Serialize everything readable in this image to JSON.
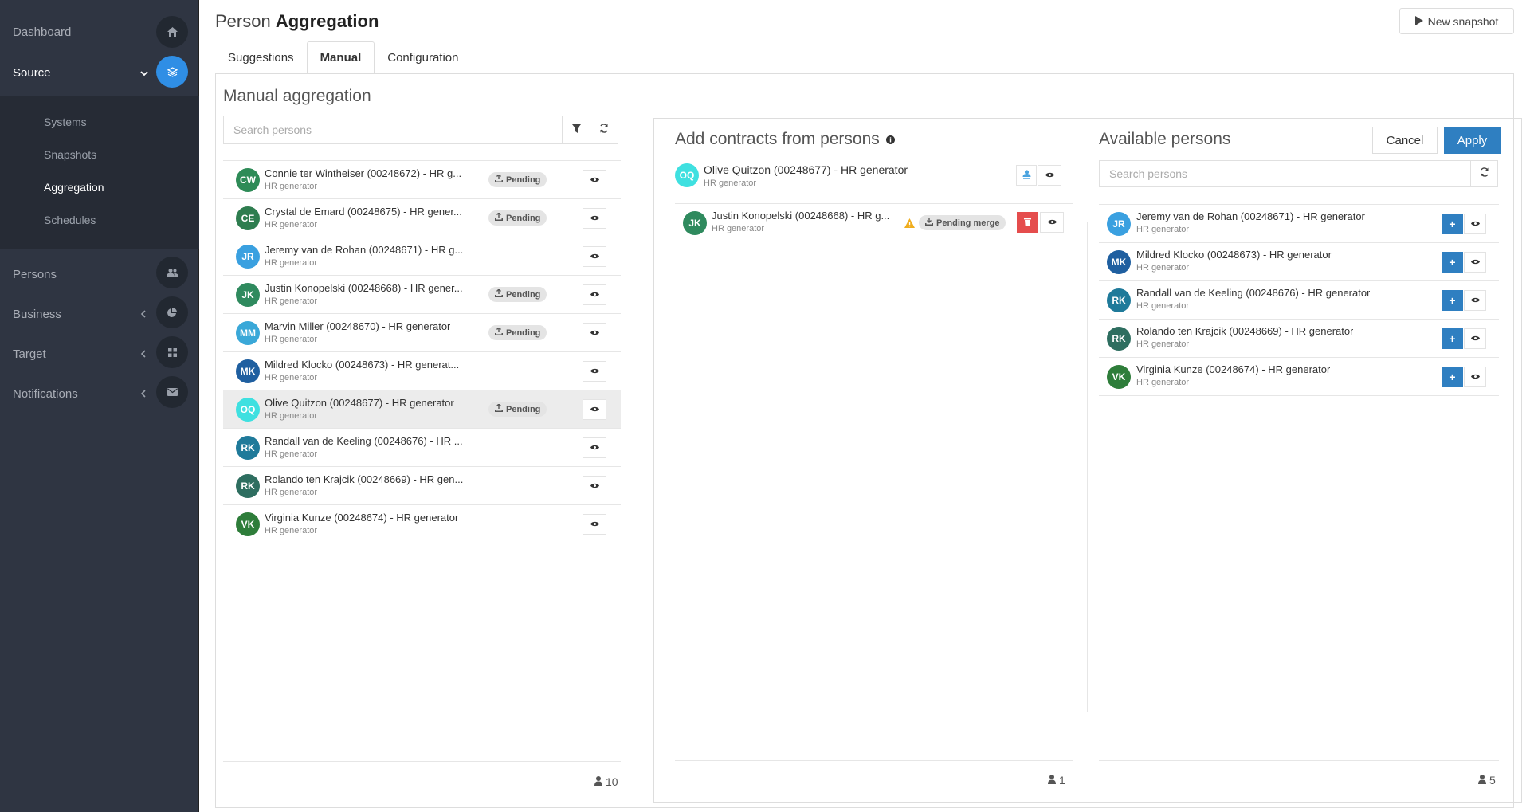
{
  "sidebar": {
    "dashboard": "Dashboard",
    "source": "Source",
    "sub": [
      "Systems",
      "Snapshots",
      "Aggregation",
      "Schedules"
    ],
    "persons": "Persons",
    "business": "Business",
    "target": "Target",
    "notifications": "Notifications"
  },
  "header": {
    "title_light": "Person",
    "title_bold": "Aggregation",
    "new_snapshot": "New snapshot"
  },
  "tabs": [
    "Suggestions",
    "Manual",
    "Configuration"
  ],
  "manual": {
    "title": "Manual aggregation",
    "search_placeholder": "Search persons",
    "count": "10",
    "persons": [
      {
        "initials": "CW",
        "color": "#2e8b57",
        "name": "Connie ter Wintheiser (00248672) - HR g...",
        "sub": "HR generator",
        "badge": "Pending"
      },
      {
        "initials": "CE",
        "color": "#2e7d4f",
        "name": "Crystal de Emard (00248675) - HR gener...",
        "sub": "HR generator",
        "badge": "Pending"
      },
      {
        "initials": "JR",
        "color": "#3aa0e0",
        "name": "Jeremy van de Rohan (00248671) - HR g...",
        "sub": "HR generator",
        "badge": ""
      },
      {
        "initials": "JK",
        "color": "#2f8a5e",
        "name": "Justin Konopelski (00248668) - HR gener...",
        "sub": "HR generator",
        "badge": "Pending"
      },
      {
        "initials": "MM",
        "color": "#3aa8d8",
        "name": "Marvin Miller (00248670) - HR generator",
        "sub": "HR generator",
        "badge": "Pending"
      },
      {
        "initials": "MK",
        "color": "#1f5fa0",
        "name": "Mildred Klocko (00248673) - HR generat...",
        "sub": "HR generator",
        "badge": ""
      },
      {
        "initials": "OQ",
        "color": "#3fe0e0",
        "name": "Olive Quitzon (00248677) - HR generator",
        "sub": "HR generator",
        "badge": "Pending"
      },
      {
        "initials": "RK",
        "color": "#1f7a9a",
        "name": "Randall van de Keeling (00248676) - HR ...",
        "sub": "HR generator",
        "badge": ""
      },
      {
        "initials": "RK",
        "color": "#2e6e60",
        "name": "Rolando ten Krajcik (00248669) - HR gen...",
        "sub": "HR generator",
        "badge": ""
      },
      {
        "initials": "VK",
        "color": "#2e7d3a",
        "name": "Virginia Kunze (00248674) - HR generator",
        "sub": "HR generator",
        "badge": ""
      }
    ]
  },
  "contracts": {
    "title": "Add contracts from persons",
    "main_person": {
      "initials": "OQ",
      "color": "#3fe0e0",
      "name": "Olive Quitzon (00248677) - HR generator",
      "sub": "HR generator"
    },
    "merge_person": {
      "initials": "JK",
      "color": "#2f8a5e",
      "name": "Justin Konopelski (00248668) - HR g...",
      "sub": "HR generator",
      "badge": "Pending merge"
    },
    "count": "1"
  },
  "available": {
    "title": "Available persons",
    "cancel": "Cancel",
    "apply": "Apply",
    "search_placeholder": "Search persons",
    "count": "5",
    "persons": [
      {
        "initials": "JR",
        "color": "#3aa0e0",
        "name": "Jeremy van de Rohan (00248671) - HR generator",
        "sub": "HR generator"
      },
      {
        "initials": "MK",
        "color": "#1f5fa0",
        "name": "Mildred Klocko (00248673) - HR generator",
        "sub": "HR generator"
      },
      {
        "initials": "RK",
        "color": "#1f7a9a",
        "name": "Randall van de Keeling (00248676) - HR generator",
        "sub": "HR generator"
      },
      {
        "initials": "RK",
        "color": "#2e6e60",
        "name": "Rolando ten Krajcik (00248669) - HR generator",
        "sub": "HR generator"
      },
      {
        "initials": "VK",
        "color": "#2e7d3a",
        "name": "Virginia Kunze (00248674) - HR generator",
        "sub": "HR generator"
      }
    ]
  },
  "colors": {
    "accent": "#2f8ee5",
    "primary_button": "#2f7fc1",
    "danger": "#e54d4d",
    "sidebar": "#2f3542"
  }
}
